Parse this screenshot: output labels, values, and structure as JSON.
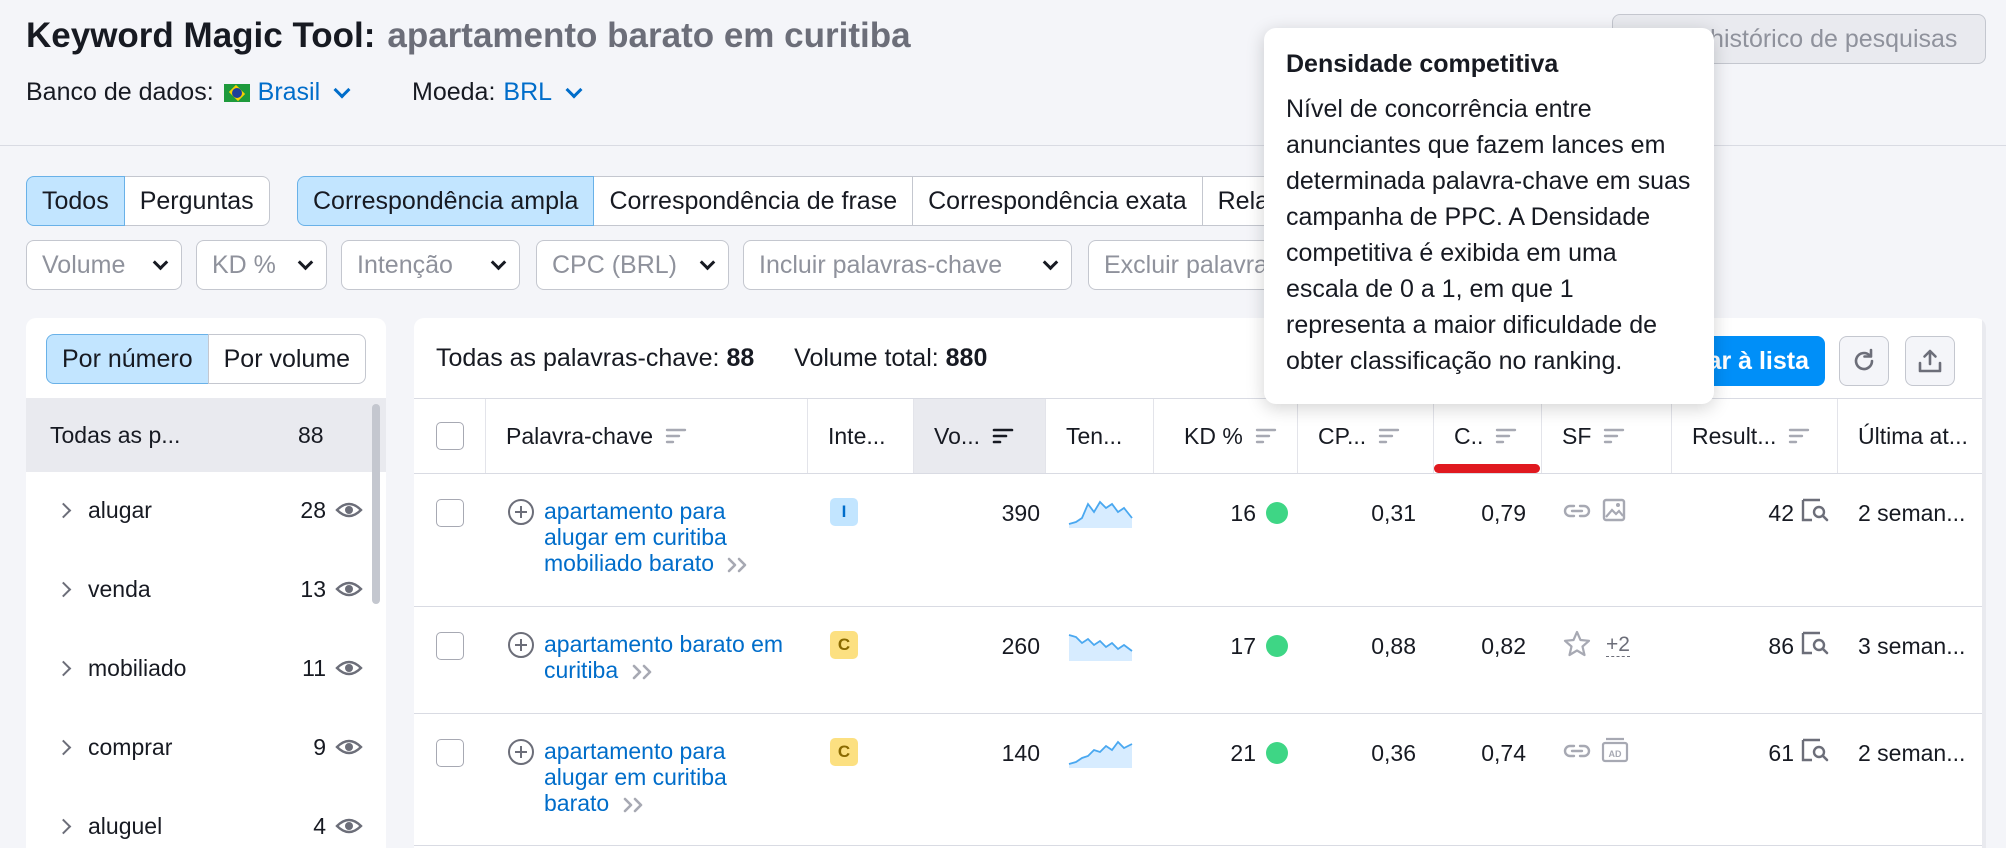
{
  "header": {
    "title": "Keyword Magic Tool:",
    "query": "apartamento barato em curitiba",
    "database_label": "Banco de dados:",
    "database_value": "Brasil",
    "currency_label": "Moeda:",
    "currency_value": "BRL",
    "history_button": "Exibir histórico de pesquisas"
  },
  "filters": {
    "question_tabs": [
      "Todos",
      "Perguntas"
    ],
    "match_tabs": [
      "Correspondência ampla",
      "Correspondência de frase",
      "Correspondência exata",
      "Relacionadas"
    ],
    "dropdowns": [
      "Volume",
      "KD %",
      "Intenção",
      "CPC (BRL)",
      "Incluir palavras-chave",
      "Excluir palavras-chave"
    ]
  },
  "groups_panel": {
    "tabs": [
      "Por número",
      "Por volume"
    ],
    "all_label": "Todas as p...",
    "all_count": "88",
    "groups": [
      {
        "name": "alugar",
        "count": "28"
      },
      {
        "name": "venda",
        "count": "13"
      },
      {
        "name": "mobiliado",
        "count": "11"
      },
      {
        "name": "comprar",
        "count": "9"
      },
      {
        "name": "aluguel",
        "count": "4"
      }
    ]
  },
  "summary": {
    "all_keywords_label": "Todas as palavras-chave:",
    "all_keywords_value": "88",
    "total_volume_label": "Volume total:",
    "total_volume_value": "880",
    "add_to_list": "Adicionar à lista"
  },
  "table": {
    "columns": [
      "Palavra-chave",
      "Inte...",
      "Vo...",
      "Ten...",
      "KD %",
      "CP...",
      "C..",
      "SF",
      "Result...",
      "Última at..."
    ],
    "rows": [
      {
        "keyword": "apartamento para alugar em curitiba mobiliado barato",
        "intent": "I",
        "volume": "390",
        "kd": "16",
        "cpc": "0,31",
        "com": "0,79",
        "sf_extra": "",
        "results": "42",
        "updated": "2 seman..."
      },
      {
        "keyword": "apartamento barato em curitiba",
        "intent": "C",
        "volume": "260",
        "kd": "17",
        "cpc": "0,88",
        "com": "0,82",
        "sf_extra": "+2",
        "results": "86",
        "updated": "3 seman..."
      },
      {
        "keyword": "apartamento para alugar em curitiba barato",
        "intent": "C",
        "volume": "140",
        "kd": "21",
        "cpc": "0,36",
        "com": "0,74",
        "sf_extra": "",
        "results": "61",
        "updated": "2 seman..."
      }
    ]
  },
  "tooltip": {
    "title": "Densidade competitiva",
    "body": "Nível de concorrência entre anunciantes que fazem lances em determinada palavra-chave em suas campanha de PPC. A Densidade competitiva é exibida em uma escala de 0 a 1, em que 1 representa a maior dificuldade de obter classificação no ranking."
  },
  "colors": {
    "accent": "#006dca",
    "primary_button": "#008ff8",
    "active_tab": "#c2e5ff",
    "intent_I": "#c2e5ff",
    "intent_C": "#fce081",
    "kd_easy": "#3ed685",
    "highlight_line": "#e0191f"
  },
  "icons": [
    "chevron-down-icon",
    "brazil-flag-icon",
    "sort-icon",
    "eye-icon",
    "chevron-right-icon",
    "add-keyword-icon",
    "double-chevron-icon",
    "sparkline-icon",
    "link-icon",
    "image-icon",
    "star-icon",
    "ad-icon",
    "serp-icon",
    "refresh-icon",
    "export-icon"
  ]
}
